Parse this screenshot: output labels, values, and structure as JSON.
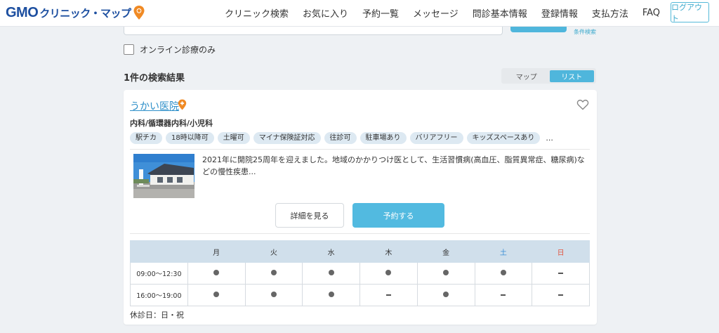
{
  "header": {
    "logo_gmo": "GMO",
    "logo_name": "クリニック・マップ",
    "nav": [
      "クリニック検索",
      "お気に入り",
      "予約一覧",
      "メッセージ",
      "問診基本情報",
      "登録情報",
      "支払方法",
      "FAQ"
    ],
    "logout_label": "ログアウト"
  },
  "search": {
    "condition_link": "条件検索",
    "online_only_label": "オンライン診療のみ"
  },
  "results": {
    "count_label": "1件の検索結果",
    "view_map": "マップ",
    "view_list": "リスト"
  },
  "clinic": {
    "name": "うかい医院",
    "departments": "内科/循環器内科/小児科",
    "tags": [
      "駅チカ",
      "18時以降可",
      "土曜可",
      "マイナ保険証対応",
      "往診可",
      "駐車場あり",
      "バリアフリー",
      "キッズスペースあり"
    ],
    "tags_more": "...",
    "description": "2021年に開院25周年を迎えました。地域のかかりつけ医として、生活習慣病(高血圧、脂質異常症、糖尿病)などの慢性疾患...",
    "detail_button": "詳細を見る",
    "reserve_button": "予約する",
    "closed_days": "休診日：日・祝"
  },
  "schedule": {
    "days": [
      "月",
      "火",
      "水",
      "木",
      "金",
      "土",
      "日"
    ],
    "rows": [
      {
        "time": "09:00〜12:30",
        "slots": [
          "open",
          "open",
          "open",
          "open",
          "open",
          "open",
          "closed"
        ]
      },
      {
        "time": "16:00〜19:00",
        "slots": [
          "open",
          "open",
          "open",
          "closed",
          "open",
          "closed",
          "closed"
        ]
      }
    ]
  },
  "colors": {
    "brand_blue": "#1d4fa0",
    "accent": "#52bae0",
    "link": "#2d8fc9",
    "saturday": "#3a8fd6",
    "sunday": "#e2553f"
  },
  "icons": {
    "logo_pin": "map-pin-icon",
    "clinic_pin": "online-pin-icon",
    "favorite": "heart-icon"
  }
}
